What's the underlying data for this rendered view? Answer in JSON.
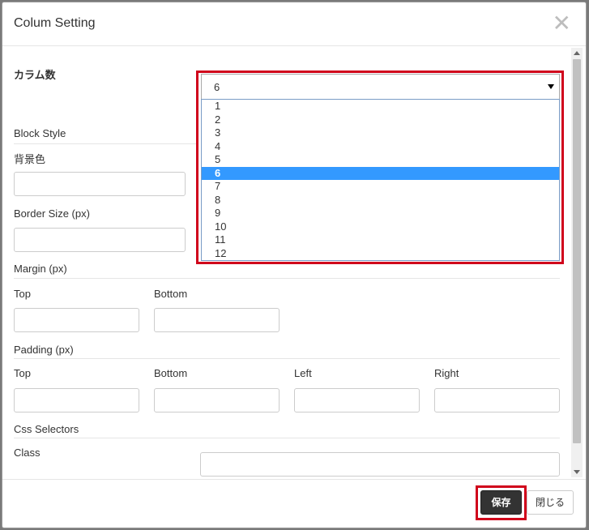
{
  "dialog": {
    "title": "Colum Setting",
    "close_icon": "close-icon"
  },
  "columns": {
    "label": "カラム数",
    "selected": "6",
    "options": [
      "1",
      "2",
      "3",
      "4",
      "5",
      "6",
      "7",
      "8",
      "9",
      "10",
      "11",
      "12"
    ]
  },
  "block_style": {
    "heading": "Block Style",
    "background_color_label": "背景色",
    "border_size_label": "Border Size (px)"
  },
  "margin": {
    "heading": "Margin (px)",
    "top_label": "Top",
    "bottom_label": "Bottom"
  },
  "padding": {
    "heading": "Padding (px)",
    "top_label": "Top",
    "bottom_label": "Bottom",
    "left_label": "Left",
    "right_label": "Right"
  },
  "css": {
    "heading": "Css Selectors",
    "class_label": "Class"
  },
  "footer": {
    "save_label": "保存",
    "close_label": "閉じる"
  },
  "colors": {
    "highlight": "#d0021b",
    "selected_option": "#3399ff",
    "save_button": "#333333"
  }
}
